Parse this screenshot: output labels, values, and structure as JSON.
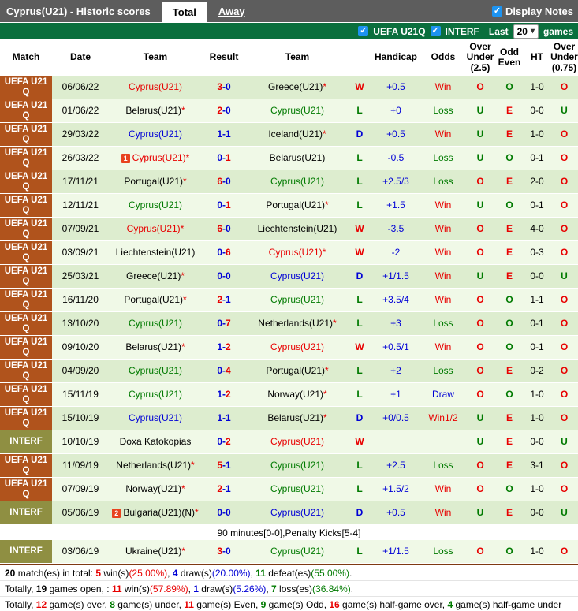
{
  "tabs": {
    "title": "Cyprus(U21) - Historic scores",
    "total": "Total",
    "away": "Away",
    "display_notes": "Display Notes",
    "check_glyph": "✓"
  },
  "filter_bar": {
    "league1": "UEFA U21Q",
    "league2": "INTERF",
    "last_label": "Last",
    "last_value": "20",
    "games_label": "games",
    "dropdown_arrow": "▾"
  },
  "colors": {
    "accent_green_bar": "#0a6f3d",
    "uefa_cell": "#b0531c",
    "interf_cell": "#8f8f42",
    "checkbox_blue": "#1d93f0",
    "win_red": "#e80000",
    "loss_green": "#007a00",
    "draw_blue": "#0000d6"
  },
  "table": {
    "headers": [
      "Match",
      "Date",
      "Team",
      "Result",
      "Team",
      "",
      "Handicap",
      "Odds",
      "Over Under (2.5)",
      "Odd Even",
      "HT",
      "Over Under (0.75)"
    ],
    "rows": [
      {
        "lg": "UEFA U21 Q",
        "lt": "uefa",
        "date": "06/06/22",
        "h": {
          "n": "Cyprus(U21)",
          "c": "red"
        },
        "s": [
          3,
          0
        ],
        "a": {
          "n": "Greece(U21)",
          "c": "black",
          "star": true
        },
        "w": "W",
        "hc": "+0.5",
        "od": "Win",
        "ou": "O",
        "oe": "O",
        "ht": "1-0",
        "ou2": "O"
      },
      {
        "lg": "UEFA U21 Q",
        "lt": "uefa",
        "date": "01/06/22",
        "h": {
          "n": "Belarus(U21)",
          "c": "black",
          "star": true
        },
        "s": [
          2,
          0
        ],
        "a": {
          "n": "Cyprus(U21)",
          "c": "green"
        },
        "w": "L",
        "hc": "+0",
        "od": "Loss",
        "ou": "U",
        "oe": "E",
        "ht": "0-0",
        "ou2": "U"
      },
      {
        "lg": "UEFA U21 Q",
        "lt": "uefa",
        "date": "29/03/22",
        "h": {
          "n": "Cyprus(U21)",
          "c": "blue"
        },
        "s": [
          1,
          1
        ],
        "a": {
          "n": "Iceland(U21)",
          "c": "black",
          "star": true
        },
        "w": "D",
        "hc": "+0.5",
        "od": "Win",
        "ou": "U",
        "oe": "E",
        "ht": "1-0",
        "ou2": "O"
      },
      {
        "lg": "UEFA U21 Q",
        "lt": "uefa",
        "date": "26/03/22",
        "h": {
          "n": "Cyprus(U21)",
          "c": "red",
          "star": true,
          "badge": "1"
        },
        "s": [
          0,
          1
        ],
        "a": {
          "n": "Belarus(U21)",
          "c": "black"
        },
        "w": "L",
        "hc": "-0.5",
        "od": "Loss",
        "ou": "U",
        "oe": "O",
        "ht": "0-1",
        "ou2": "O"
      },
      {
        "lg": "UEFA U21 Q",
        "lt": "uefa",
        "date": "17/11/21",
        "h": {
          "n": "Portugal(U21)",
          "c": "black",
          "star": true
        },
        "s": [
          6,
          0
        ],
        "a": {
          "n": "Cyprus(U21)",
          "c": "green"
        },
        "w": "L",
        "hc": "+2.5/3",
        "od": "Loss",
        "ou": "O",
        "oe": "E",
        "ht": "2-0",
        "ou2": "O"
      },
      {
        "lg": "UEFA U21 Q",
        "lt": "uefa",
        "date": "12/11/21",
        "h": {
          "n": "Cyprus(U21)",
          "c": "green"
        },
        "s": [
          0,
          1
        ],
        "a": {
          "n": "Portugal(U21)",
          "c": "black",
          "star": true
        },
        "w": "L",
        "hc": "+1.5",
        "od": "Win",
        "ou": "U",
        "oe": "O",
        "ht": "0-1",
        "ou2": "O"
      },
      {
        "lg": "UEFA U21 Q",
        "lt": "uefa",
        "date": "07/09/21",
        "h": {
          "n": "Cyprus(U21)",
          "c": "red",
          "star": true
        },
        "s": [
          6,
          0
        ],
        "a": {
          "n": "Liechtenstein(U21)",
          "c": "black"
        },
        "w": "W",
        "hc": "-3.5",
        "od": "Win",
        "ou": "O",
        "oe": "E",
        "ht": "4-0",
        "ou2": "O"
      },
      {
        "lg": "UEFA U21 Q",
        "lt": "uefa",
        "date": "03/09/21",
        "h": {
          "n": "Liechtenstein(U21)",
          "c": "black"
        },
        "s": [
          0,
          6
        ],
        "a": {
          "n": "Cyprus(U21)",
          "c": "red",
          "star": true
        },
        "w": "W",
        "hc": "-2",
        "od": "Win",
        "ou": "O",
        "oe": "E",
        "ht": "0-3",
        "ou2": "O"
      },
      {
        "lg": "UEFA U21 Q",
        "lt": "uefa",
        "date": "25/03/21",
        "h": {
          "n": "Greece(U21)",
          "c": "black",
          "star": true
        },
        "s": [
          0,
          0
        ],
        "a": {
          "n": "Cyprus(U21)",
          "c": "blue"
        },
        "w": "D",
        "hc": "+1/1.5",
        "od": "Win",
        "ou": "U",
        "oe": "E",
        "ht": "0-0",
        "ou2": "U"
      },
      {
        "lg": "UEFA U21 Q",
        "lt": "uefa",
        "date": "16/11/20",
        "h": {
          "n": "Portugal(U21)",
          "c": "black",
          "star": true
        },
        "s": [
          2,
          1
        ],
        "a": {
          "n": "Cyprus(U21)",
          "c": "green"
        },
        "w": "L",
        "hc": "+3.5/4",
        "od": "Win",
        "ou": "O",
        "oe": "O",
        "ht": "1-1",
        "ou2": "O"
      },
      {
        "lg": "UEFA U21 Q",
        "lt": "uefa",
        "date": "13/10/20",
        "h": {
          "n": "Cyprus(U21)",
          "c": "green"
        },
        "s": [
          0,
          7
        ],
        "a": {
          "n": "Netherlands(U21)",
          "c": "black",
          "star": true
        },
        "w": "L",
        "hc": "+3",
        "od": "Loss",
        "ou": "O",
        "oe": "O",
        "ht": "0-1",
        "ou2": "O"
      },
      {
        "lg": "UEFA U21 Q",
        "lt": "uefa",
        "date": "09/10/20",
        "h": {
          "n": "Belarus(U21)",
          "c": "black",
          "star": true
        },
        "s": [
          1,
          2
        ],
        "a": {
          "n": "Cyprus(U21)",
          "c": "red"
        },
        "w": "W",
        "hc": "+0.5/1",
        "od": "Win",
        "ou": "O",
        "oe": "O",
        "ht": "0-1",
        "ou2": "O"
      },
      {
        "lg": "UEFA U21 Q",
        "lt": "uefa",
        "date": "04/09/20",
        "h": {
          "n": "Cyprus(U21)",
          "c": "green"
        },
        "s": [
          0,
          4
        ],
        "a": {
          "n": "Portugal(U21)",
          "c": "black",
          "star": true
        },
        "w": "L",
        "hc": "+2",
        "od": "Loss",
        "ou": "O",
        "oe": "E",
        "ht": "0-2",
        "ou2": "O"
      },
      {
        "lg": "UEFA U21 Q",
        "lt": "uefa",
        "date": "15/11/19",
        "h": {
          "n": "Cyprus(U21)",
          "c": "green"
        },
        "s": [
          1,
          2
        ],
        "a": {
          "n": "Norway(U21)",
          "c": "black",
          "star": true
        },
        "w": "L",
        "hc": "+1",
        "od": "Draw",
        "ou": "O",
        "oe": "O",
        "ht": "1-0",
        "ou2": "O"
      },
      {
        "lg": "UEFA U21 Q",
        "lt": "uefa",
        "date": "15/10/19",
        "h": {
          "n": "Cyprus(U21)",
          "c": "blue"
        },
        "s": [
          1,
          1
        ],
        "a": {
          "n": "Belarus(U21)",
          "c": "black",
          "star": true
        },
        "w": "D",
        "hc": "+0/0.5",
        "od": "Win1/2",
        "ou": "U",
        "oe": "E",
        "ht": "1-0",
        "ou2": "O"
      },
      {
        "lg": "INTERF",
        "lt": "interf",
        "date": "10/10/19",
        "h": {
          "n": "Doxa Katokopias",
          "c": "black"
        },
        "s": [
          0,
          2
        ],
        "a": {
          "n": "Cyprus(U21)",
          "c": "red"
        },
        "w": "W",
        "hc": "",
        "od": "",
        "ou": "U",
        "oe": "E",
        "ht": "0-0",
        "ou2": "U"
      },
      {
        "lg": "UEFA U21 Q",
        "lt": "uefa",
        "date": "11/09/19",
        "h": {
          "n": "Netherlands(U21)",
          "c": "black",
          "star": true
        },
        "s": [
          5,
          1
        ],
        "a": {
          "n": "Cyprus(U21)",
          "c": "green"
        },
        "w": "L",
        "hc": "+2.5",
        "od": "Loss",
        "ou": "O",
        "oe": "E",
        "ht": "3-1",
        "ou2": "O"
      },
      {
        "lg": "UEFA U21 Q",
        "lt": "uefa",
        "date": "07/09/19",
        "h": {
          "n": "Norway(U21)",
          "c": "black",
          "star": true
        },
        "s": [
          2,
          1
        ],
        "a": {
          "n": "Cyprus(U21)",
          "c": "green"
        },
        "w": "L",
        "hc": "+1.5/2",
        "od": "Win",
        "ou": "O",
        "oe": "O",
        "ht": "1-0",
        "ou2": "O"
      },
      {
        "lg": "INTERF",
        "lt": "interf",
        "date": "05/06/19",
        "h": {
          "n": "Bulgaria(U21)(N)",
          "c": "black",
          "star": true,
          "badge": "2"
        },
        "s": [
          0,
          0
        ],
        "a": {
          "n": "Cyprus(U21)",
          "c": "blue"
        },
        "w": "D",
        "hc": "+0.5",
        "od": "Win",
        "ou": "U",
        "oe": "E",
        "ht": "0-0",
        "ou2": "U",
        "note": "90 minutes[0-0],Penalty Kicks[5-4]"
      },
      {
        "lg": "INTERF",
        "lt": "interf",
        "date": "03/06/19",
        "h": {
          "n": "Ukraine(U21)",
          "c": "black",
          "star": true
        },
        "s": [
          3,
          0
        ],
        "a": {
          "n": "Cyprus(U21)",
          "c": "green"
        },
        "w": "L",
        "hc": "+1/1.5",
        "od": "Loss",
        "ou": "O",
        "oe": "O",
        "ht": "1-0",
        "ou2": "O"
      }
    ]
  },
  "footer": {
    "lines": [
      [
        {
          "t": "20",
          "c": "black",
          "b": true
        },
        {
          "t": " match(es) in total: ",
          "c": "black"
        },
        {
          "t": "5",
          "c": "red",
          "b": true
        },
        {
          "t": " win(s)",
          "c": "black"
        },
        {
          "t": "(25.00%)",
          "c": "red"
        },
        {
          "t": ", ",
          "c": "black"
        },
        {
          "t": "4",
          "c": "blue",
          "b": true
        },
        {
          "t": " draw(s)",
          "c": "black"
        },
        {
          "t": "(20.00%)",
          "c": "blue"
        },
        {
          "t": ", ",
          "c": "black"
        },
        {
          "t": "11",
          "c": "green",
          "b": true
        },
        {
          "t": " defeat(es)",
          "c": "black"
        },
        {
          "t": "(55.00%)",
          "c": "green"
        },
        {
          "t": ".",
          "c": "black"
        }
      ],
      [
        {
          "t": "Totally, ",
          "c": "black"
        },
        {
          "t": "19",
          "c": "black",
          "b": true
        },
        {
          "t": " games open, : ",
          "c": "black"
        },
        {
          "t": "11",
          "c": "red",
          "b": true
        },
        {
          "t": " win(s)",
          "c": "black"
        },
        {
          "t": "(57.89%)",
          "c": "red"
        },
        {
          "t": ", ",
          "c": "black"
        },
        {
          "t": "1",
          "c": "blue",
          "b": true
        },
        {
          "t": " draw(s)",
          "c": "black"
        },
        {
          "t": "(5.26%)",
          "c": "blue"
        },
        {
          "t": ", ",
          "c": "black"
        },
        {
          "t": "7",
          "c": "green",
          "b": true
        },
        {
          "t": " loss(es)",
          "c": "black"
        },
        {
          "t": "(36.84%)",
          "c": "green"
        },
        {
          "t": ".",
          "c": "black"
        }
      ],
      [
        {
          "t": "Totally, ",
          "c": "black"
        },
        {
          "t": "12",
          "c": "red",
          "b": true
        },
        {
          "t": " game(s) over, ",
          "c": "black"
        },
        {
          "t": "8",
          "c": "green",
          "b": true
        },
        {
          "t": " game(s) under, ",
          "c": "black"
        },
        {
          "t": "11",
          "c": "red",
          "b": true
        },
        {
          "t": " game(s) Even, ",
          "c": "black"
        },
        {
          "t": "9",
          "c": "green",
          "b": true
        },
        {
          "t": " game(s) Odd, ",
          "c": "black"
        },
        {
          "t": "16",
          "c": "red",
          "b": true
        },
        {
          "t": " game(s) half-game over, ",
          "c": "black"
        },
        {
          "t": "4",
          "c": "green",
          "b": true
        },
        {
          "t": " game(s) half-game under",
          "c": "black"
        }
      ]
    ]
  }
}
